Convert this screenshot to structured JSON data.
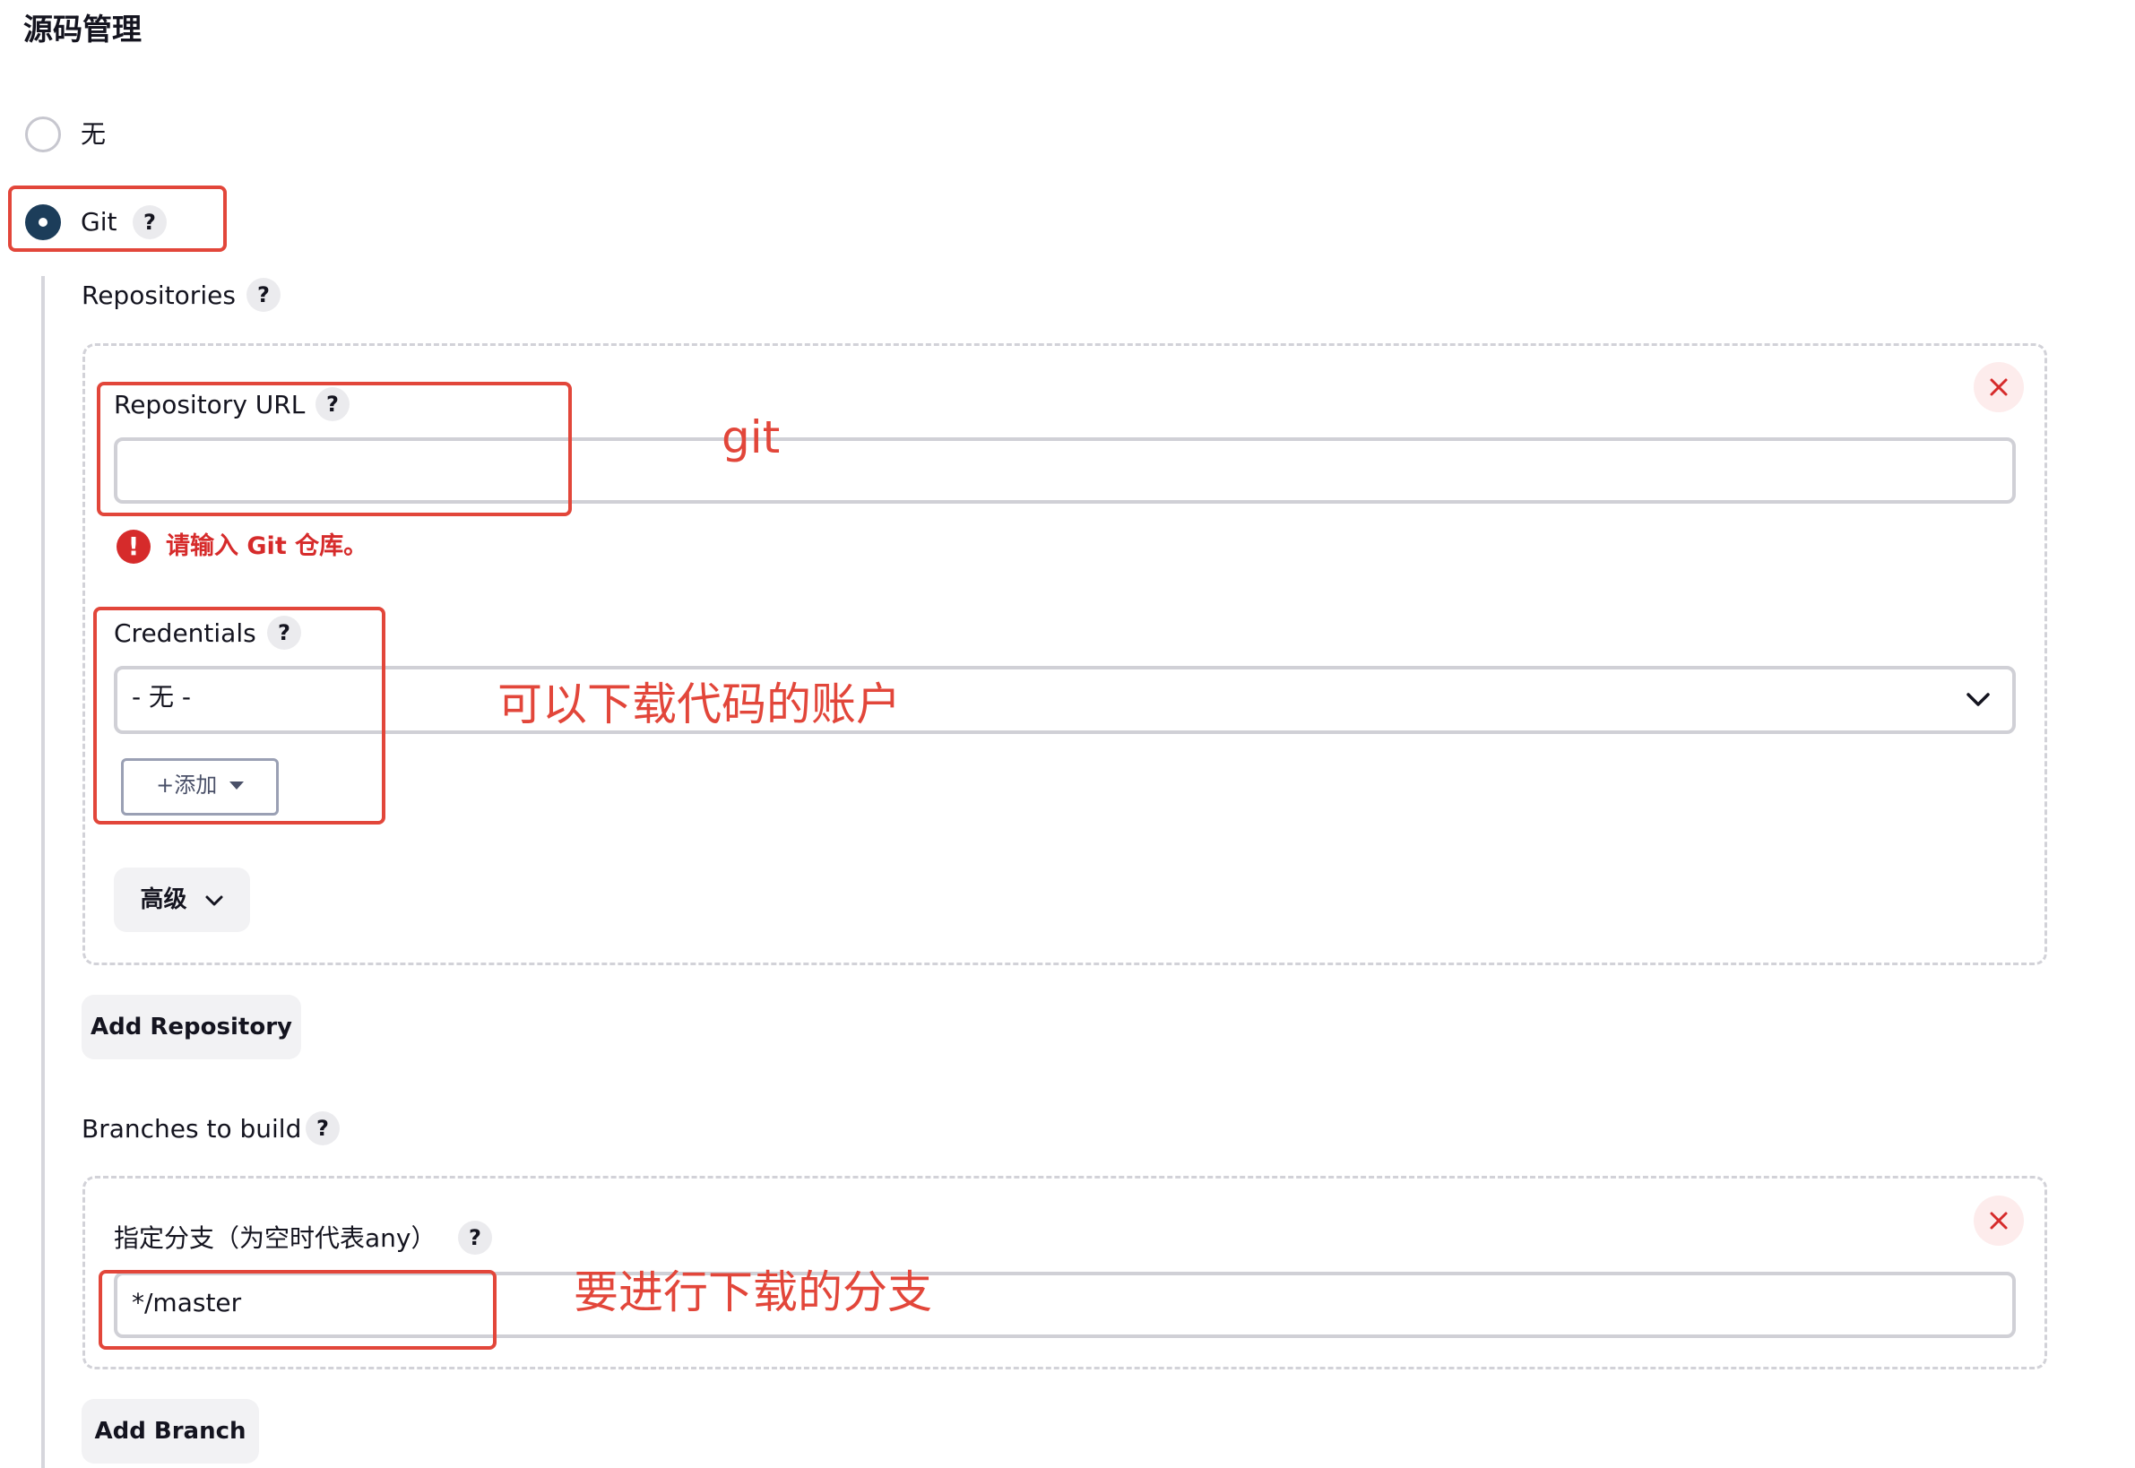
{
  "section_title": "源码管理",
  "scm_options": {
    "none_label": "无",
    "git_label": "Git"
  },
  "help_glyph": "?",
  "repositories": {
    "label": "Repositories",
    "repository_url": {
      "label": "Repository URL",
      "value": ""
    },
    "validation_error": "请输入 Git 仓库。",
    "credentials": {
      "label": "Credentials",
      "selected": "- 无 -",
      "add_button": "添加"
    },
    "advanced_button": "高级",
    "add_repository_button": "Add Repository"
  },
  "branches": {
    "label": "Branches to build",
    "branch_specifier_label": "指定分支（为空时代表any）",
    "branch_specifier_value": "*/master",
    "add_branch_button": "Add Branch"
  },
  "annotations": {
    "repo_url_note": "git",
    "credentials_note": "可以下载代码的账户",
    "branch_note": "要进行下载的分支"
  },
  "colors": {
    "accent": "#1c3d5a",
    "error": "#d62b2b",
    "annotation": "#e2463a"
  },
  "icons": [
    "help-icon",
    "close-icon",
    "error-icon",
    "chevron-down-icon",
    "plus-icon",
    "caret-down-icon"
  ]
}
